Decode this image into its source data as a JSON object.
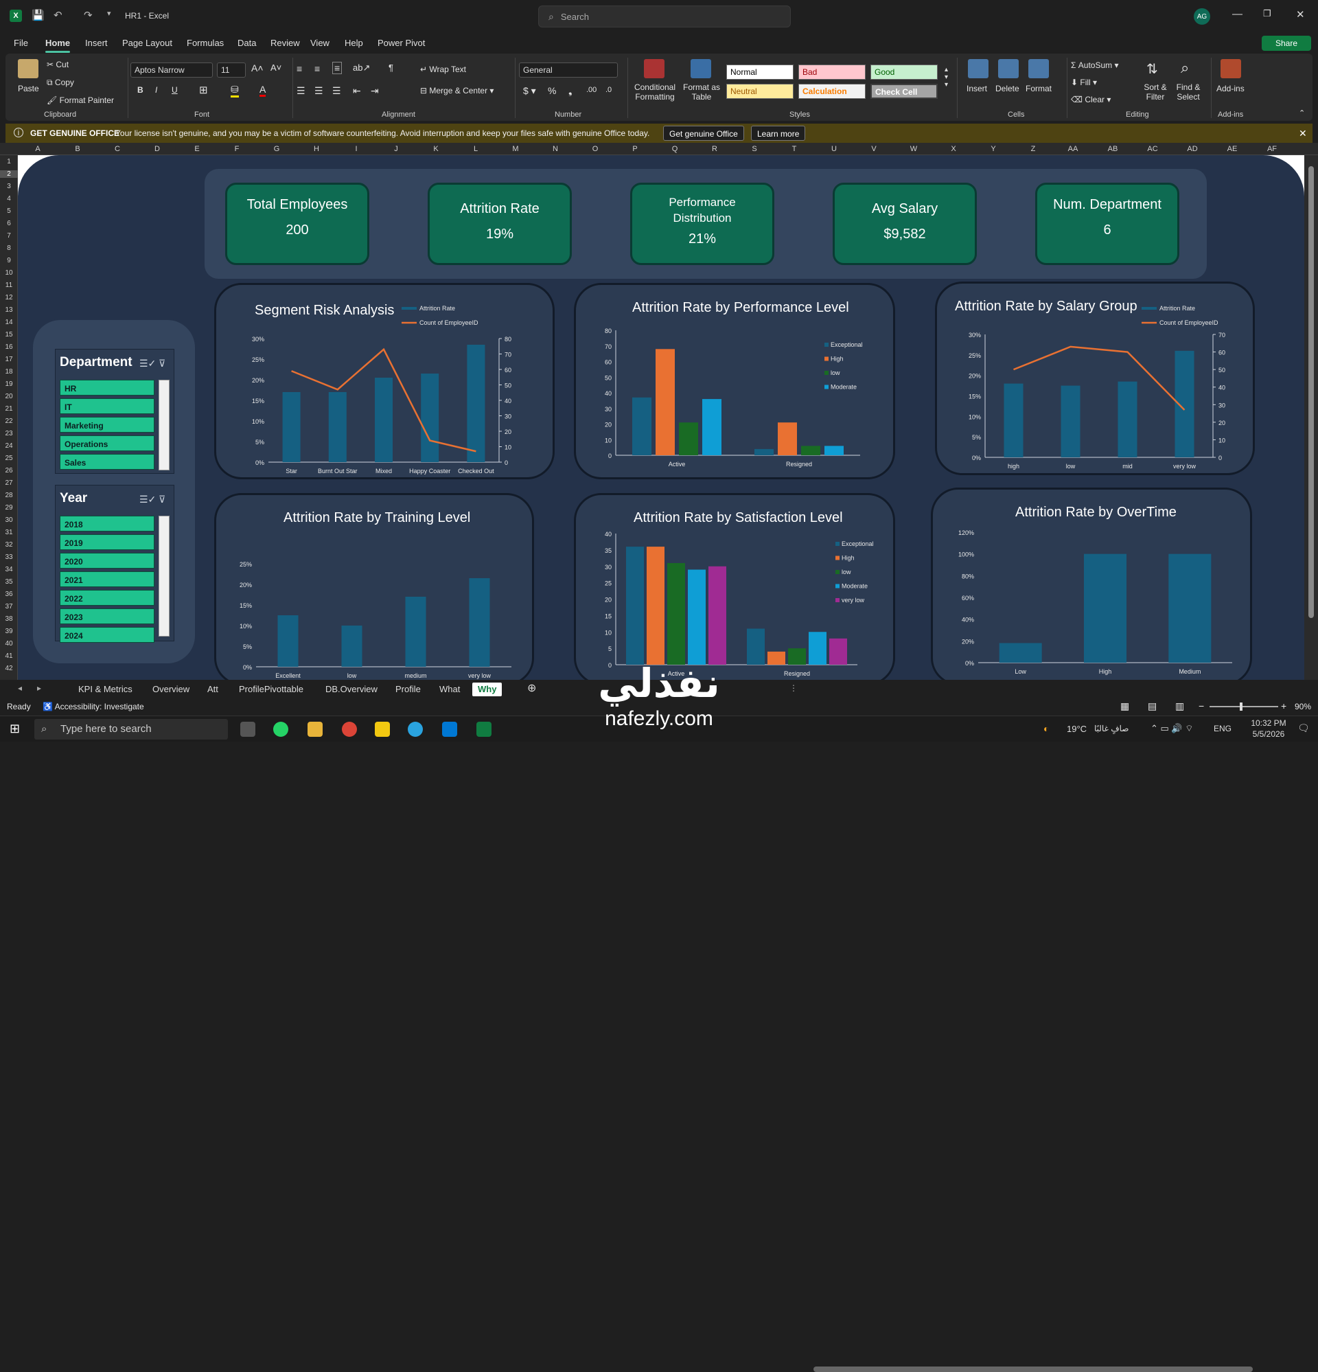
{
  "window": {
    "title": "HR1 - Excel",
    "search_placeholder": "Search",
    "avatar": "AG"
  },
  "menu": [
    "File",
    "Home",
    "Insert",
    "Page Layout",
    "Formulas",
    "Data",
    "Review",
    "View",
    "Help",
    "Power Pivot"
  ],
  "share_label": "Share",
  "ribbon": {
    "paste": "Paste",
    "cut": "Cut",
    "copy": "Copy",
    "format_painter": "Format Painter",
    "font_name": "Aptos Narrow",
    "font_size": "11",
    "wrap_text": "Wrap Text",
    "merge_center": "Merge & Center",
    "number_format": "General",
    "conditional_formatting": "Conditional Formatting",
    "format_as_table": "Format as Table",
    "styles": {
      "normal": "Normal",
      "bad": "Bad",
      "good": "Good",
      "neutral": "Neutral",
      "calculation": "Calculation",
      "check_cell": "Check Cell"
    },
    "insert": "Insert",
    "delete": "Delete",
    "format": "Format",
    "autosum": "AutoSum",
    "fill": "Fill",
    "clear": "Clear",
    "sort_filter": "Sort & Filter",
    "find_select": "Find & Select",
    "addins": "Add-ins",
    "groups": {
      "clipboard": "Clipboard",
      "font": "Font",
      "alignment": "Alignment",
      "number": "Number",
      "styles": "Styles",
      "cells": "Cells",
      "editing": "Editing",
      "addins": "Add-ins"
    }
  },
  "banner": {
    "title": "GET GENUINE OFFICE",
    "message": "Your license isn't genuine, and you may be a victim of software counterfeiting. Avoid interruption and keep your files safe with genuine Office today.",
    "btn1": "Get genuine Office",
    "btn2": "Learn more"
  },
  "columns": [
    "A",
    "B",
    "C",
    "D",
    "E",
    "F",
    "G",
    "H",
    "I",
    "J",
    "K",
    "L",
    "M",
    "N",
    "O",
    "P",
    "Q",
    "R",
    "S",
    "T",
    "U",
    "V",
    "W",
    "X",
    "Y",
    "Z",
    "AA",
    "AB",
    "AC",
    "AD",
    "AE",
    "AF"
  ],
  "rows": [
    "1",
    "2",
    "3",
    "4",
    "5",
    "6",
    "7",
    "8",
    "9",
    "10",
    "11",
    "12",
    "13",
    "14",
    "15",
    "16",
    "17",
    "18",
    "19",
    "20",
    "21",
    "22",
    "23",
    "24",
    "25",
    "26",
    "27",
    "28",
    "29",
    "30",
    "31",
    "32",
    "33",
    "34",
    "35",
    "36",
    "37",
    "38",
    "39",
    "40",
    "41",
    "42"
  ],
  "kpis": [
    {
      "title": "Total Employees",
      "value": "200"
    },
    {
      "title": "Attrition Rate",
      "value": "19%"
    },
    {
      "title": "Performance Distribution",
      "value": "21%"
    },
    {
      "title": "Avg Salary",
      "value": "$9,582"
    },
    {
      "title": "Num. Department",
      "value": "6"
    }
  ],
  "slicers": {
    "department": {
      "title": "Department",
      "items": [
        "HR",
        "IT",
        "Marketing",
        "Operations",
        "Sales"
      ]
    },
    "year": {
      "title": "Year",
      "items": [
        "2018",
        "2019",
        "2020",
        "2021",
        "2022",
        "2023",
        "2024"
      ]
    }
  },
  "chart_data": [
    {
      "id": "segment",
      "type": "bar",
      "title": "Segment Risk Analysis",
      "categories": [
        "Star",
        "Burnt Out Star",
        "Mixed",
        "Happy Coaster",
        "Checked Out"
      ],
      "series": [
        {
          "name": "Attrition Rate",
          "kind": "bar",
          "axis": "left",
          "values": [
            17,
            17,
            20.5,
            21.5,
            28.5
          ]
        },
        {
          "name": "Count of EmployeeID",
          "kind": "line",
          "axis": "right",
          "values": [
            59,
            47,
            73,
            14,
            7
          ]
        }
      ],
      "yticks_left": [
        "0%",
        "5%",
        "10%",
        "15%",
        "20%",
        "25%",
        "30%"
      ],
      "ylim_left": [
        0,
        30
      ],
      "yticks_right": [
        "0",
        "10",
        "20",
        "30",
        "40",
        "50",
        "60",
        "70",
        "80"
      ],
      "ylim_right": [
        0,
        80
      ],
      "colors": {
        "bar": "#156082",
        "line": "#e97132"
      }
    },
    {
      "id": "performance",
      "type": "bar",
      "title": "Attrition Rate by Performance Level",
      "categories": [
        "Active",
        "Resigned"
      ],
      "series": [
        {
          "name": "Exceptional",
          "values": [
            37,
            4
          ]
        },
        {
          "name": "High",
          "values": [
            68,
            21
          ]
        },
        {
          "name": "low",
          "values": [
            21,
            6
          ]
        },
        {
          "name": "Moderate",
          "values": [
            36,
            6
          ]
        }
      ],
      "yticks": [
        "0",
        "10",
        "20",
        "30",
        "40",
        "50",
        "60",
        "70",
        "80"
      ],
      "ylim": [
        0,
        80
      ],
      "colors": [
        "#156082",
        "#e97132",
        "#196b24",
        "#0f9ed5"
      ]
    },
    {
      "id": "salary",
      "type": "bar",
      "title": "Attrition Rate by Salary Group",
      "categories": [
        "high",
        "low",
        "mid",
        "very low"
      ],
      "series": [
        {
          "name": "Attrition Rate",
          "kind": "bar",
          "axis": "left",
          "values": [
            18,
            17.5,
            18.5,
            26
          ]
        },
        {
          "name": "Count of EmployeeID",
          "kind": "line",
          "axis": "right",
          "values": [
            50,
            63,
            60,
            27
          ]
        }
      ],
      "yticks_left": [
        "0%",
        "5%",
        "10%",
        "15%",
        "20%",
        "25%",
        "30%"
      ],
      "ylim_left": [
        0,
        30
      ],
      "yticks_right": [
        "0",
        "10",
        "20",
        "30",
        "40",
        "50",
        "60",
        "70"
      ],
      "ylim_right": [
        0,
        70
      ],
      "colors": {
        "bar": "#156082",
        "line": "#e97132"
      }
    },
    {
      "id": "training",
      "type": "bar",
      "title": "Attrition Rate by Training Level",
      "categories": [
        "Excellent",
        "low",
        "medium",
        "very low"
      ],
      "series": [
        {
          "values": [
            12.5,
            10,
            17,
            21.5
          ]
        }
      ],
      "yticks": [
        "0%",
        "5%",
        "10%",
        "15%",
        "20%",
        "25%"
      ],
      "ylim": [
        0,
        25
      ],
      "colors": [
        "#156082"
      ]
    },
    {
      "id": "satisfaction",
      "type": "bar",
      "title": "Attrition Rate by Satisfaction Level",
      "categories": [
        "Active",
        "Resigned"
      ],
      "series": [
        {
          "name": "Exceptional",
          "values": [
            36,
            11
          ]
        },
        {
          "name": "High",
          "values": [
            36,
            4
          ]
        },
        {
          "name": "low",
          "values": [
            31,
            5
          ]
        },
        {
          "name": "Moderate",
          "values": [
            29,
            10
          ]
        },
        {
          "name": "very low",
          "values": [
            30,
            8
          ]
        }
      ],
      "yticks": [
        "0",
        "5",
        "10",
        "15",
        "20",
        "25",
        "30",
        "35",
        "40"
      ],
      "ylim": [
        0,
        40
      ],
      "colors": [
        "#156082",
        "#e97132",
        "#196b24",
        "#0f9ed5",
        "#a02b93"
      ]
    },
    {
      "id": "overtime",
      "type": "bar",
      "title": "Attrition Rate by OverTime",
      "categories": [
        "Low",
        "High",
        "Medium"
      ],
      "series": [
        {
          "values": [
            18,
            100,
            100
          ]
        }
      ],
      "yticks": [
        "0%",
        "20%",
        "40%",
        "60%",
        "80%",
        "100%",
        "120%"
      ],
      "ylim": [
        0,
        120
      ],
      "colors": [
        "#156082"
      ]
    }
  ],
  "sheet_tabs": [
    "KPI & Metrics",
    "Overview",
    "Att",
    "ProfilePivottable",
    "DB.Overview",
    "Profile",
    "What",
    "Why"
  ],
  "active_tab": "Why",
  "status": {
    "ready": "Ready",
    "accessibility": "Accessibility: Investigate",
    "zoom": "90%"
  },
  "taskbar": {
    "search_placeholder": "Type here to search",
    "weather": "19°C",
    "weather_text": "صافٍ غالبًا",
    "lang": "ENG",
    "time": "10:32 PM",
    "date": "5/5/2026"
  },
  "watermark": {
    "line1": "نفذلي",
    "line2": "nafezly.com"
  }
}
